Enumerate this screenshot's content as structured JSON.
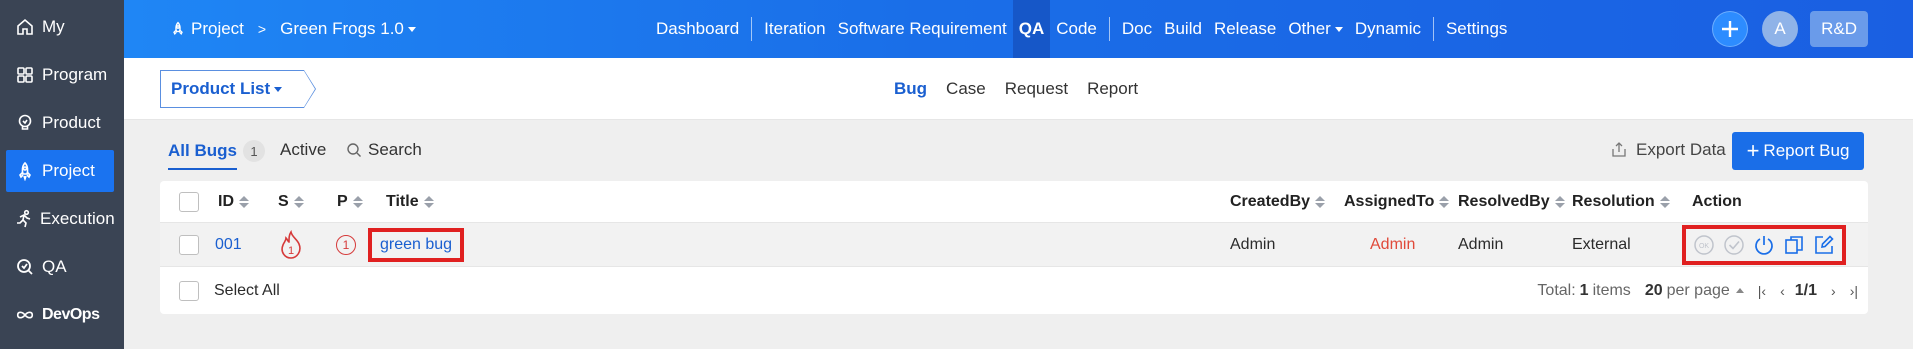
{
  "sidebar": {
    "items": [
      {
        "label": "My",
        "icon": "home-icon"
      },
      {
        "label": "Program",
        "icon": "grid-icon"
      },
      {
        "label": "Product",
        "icon": "lightbulb-icon"
      },
      {
        "label": "Project",
        "icon": "rocket-icon"
      },
      {
        "label": "Execution",
        "icon": "runner-icon"
      },
      {
        "label": "QA",
        "icon": "qa-icon"
      },
      {
        "label": "DevOps",
        "icon": "infinity-icon"
      }
    ],
    "active": "Project"
  },
  "topbar": {
    "project_label": "Project",
    "separator": ">",
    "project_name": "Green Frogs 1.0",
    "nav": [
      "Dashboard",
      "Iteration",
      "Software Requirement",
      "QA",
      "Code",
      "Doc",
      "Build",
      "Release",
      "Other",
      "Dynamic",
      "Settings"
    ],
    "active_nav": "QA",
    "avatar_letter": "A",
    "team_badge": "R&D"
  },
  "subbar": {
    "product_list": "Product List",
    "tabs": [
      "Bug",
      "Case",
      "Request",
      "Report"
    ],
    "active_tab": "Bug"
  },
  "filter": {
    "all_bugs": "All Bugs",
    "all_bugs_count": "1",
    "active": "Active",
    "search": "Search",
    "export": "Export Data",
    "report_bug": "Report Bug"
  },
  "table": {
    "headers": {
      "id": "ID",
      "s": "S",
      "p": "P",
      "title": "Title",
      "created_by": "CreatedBy",
      "assigned_to": "AssignedTo",
      "resolved_by": "ResolvedBy",
      "resolution": "Resolution",
      "action": "Action"
    },
    "rows": [
      {
        "id": "001",
        "severity": "1",
        "priority": "1",
        "title": "green bug",
        "created_by": "Admin",
        "assigned_to": "Admin",
        "resolved_by": "Admin",
        "resolution": "External"
      }
    ],
    "select_all": "Select All"
  },
  "pager": {
    "total_prefix": "Total:",
    "total": "1",
    "total_suffix": "items",
    "per_page": "20",
    "per_page_suffix": "per page",
    "page": "1/1"
  },
  "colors": {
    "accent": "#1a6ee8",
    "sidebar_bg": "#3a4454",
    "highlight_red": "#e02020"
  }
}
